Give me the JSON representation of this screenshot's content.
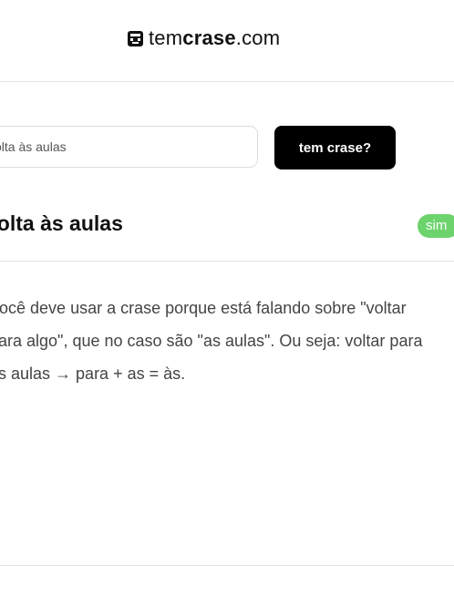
{
  "logo": {
    "prefix": "tem",
    "bold": "crase",
    "suffix": ".com"
  },
  "search": {
    "value": "volta às aulas",
    "button_label": "tem crase?"
  },
  "result": {
    "title": "volta às aulas",
    "badge": "sim",
    "badge_color": "#6dd36d",
    "explanation_lines": [
      "Você deve usar a crase porque está falando sobre \"voltar",
      "para algo\", que no caso são \"as aulas\". Ou seja: voltar para",
      "as aulas → para + as = às."
    ]
  },
  "icons": {
    "logo": "face-logo-icon"
  }
}
